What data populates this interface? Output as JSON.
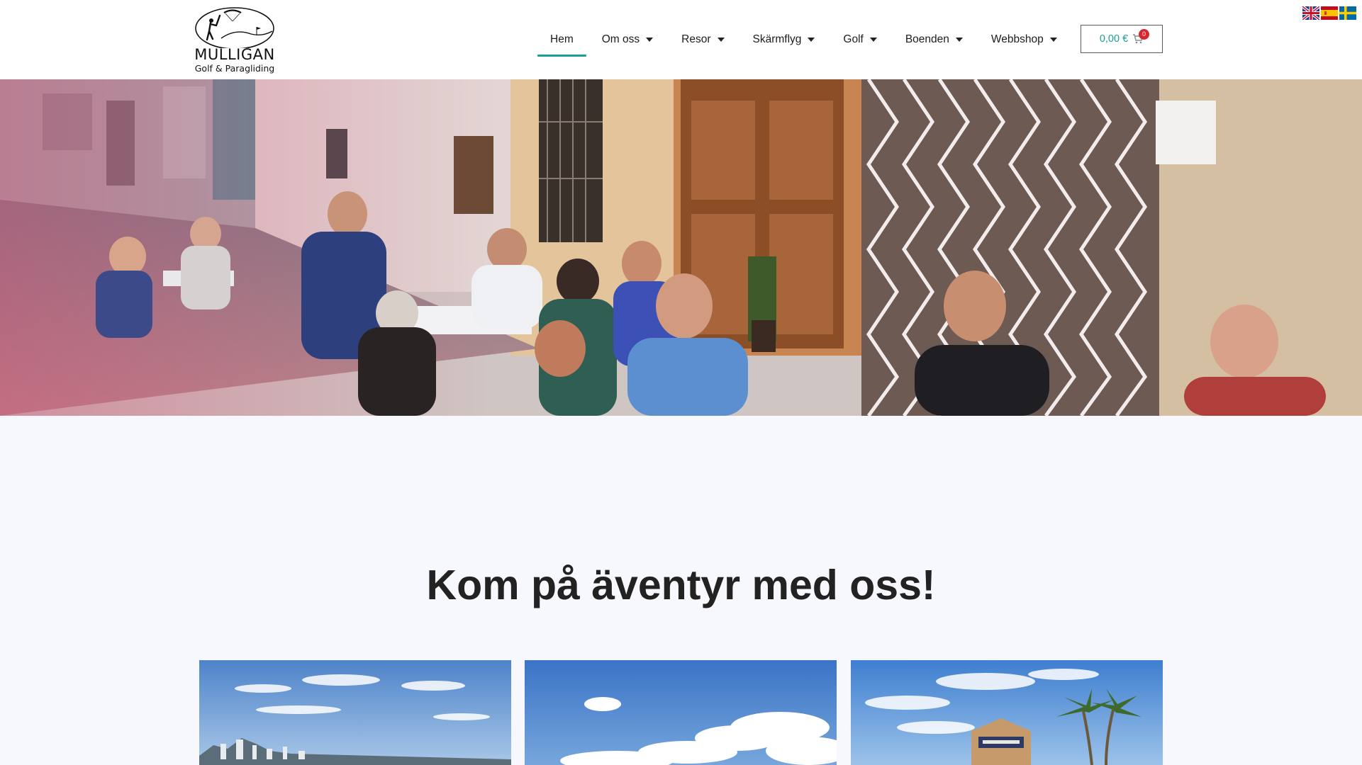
{
  "brand": {
    "name": "MULLIGAN",
    "tagline": "Golf & Paragliding"
  },
  "nav": {
    "items": [
      {
        "label": "Hem",
        "active": true,
        "dropdown": false
      },
      {
        "label": "Om oss",
        "active": false,
        "dropdown": true
      },
      {
        "label": "Resor",
        "active": false,
        "dropdown": true
      },
      {
        "label": "Skärmflyg",
        "active": false,
        "dropdown": true
      },
      {
        "label": "Golf",
        "active": false,
        "dropdown": true
      },
      {
        "label": "Boenden",
        "active": false,
        "dropdown": true
      },
      {
        "label": "Webbshop",
        "active": false,
        "dropdown": true
      }
    ],
    "accent_color": "#1aa092"
  },
  "cart": {
    "total": "0,00 €",
    "count": "0",
    "icon": "cart-icon"
  },
  "language_flags": [
    {
      "name": "english-flag-icon"
    },
    {
      "name": "spanish-flag-icon"
    },
    {
      "name": "swedish-flag-icon"
    }
  ],
  "hero": {
    "image": "hero-image"
  },
  "main": {
    "headline": "Kom på äventyr med oss!",
    "cards": [
      {
        "name": "card-coastal-city"
      },
      {
        "name": "card-sky-clouds"
      },
      {
        "name": "card-golf-clubhouse"
      }
    ]
  }
}
